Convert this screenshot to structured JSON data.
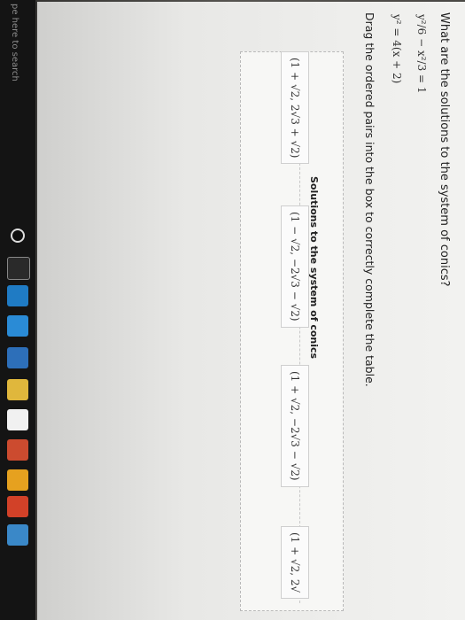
{
  "taskbar": {
    "search_placeholder": "pe here to search"
  },
  "question": "What are the solutions to the system of conics?",
  "equations": [
    "y²/6 − x²/3 = 1",
    "y² = 4(x + 2)"
  ],
  "instruction": "Drag the ordered pairs into the box to correctly complete the table.",
  "table": {
    "header": "Solutions to the system of conics"
  },
  "choices": [
    "(1 + √2, 2√3 + √2)",
    "(1 − √2, −2√3 − √2)",
    "(1 + √2, −2√3 − √2)",
    "(1 + √2, 2√"
  ]
}
